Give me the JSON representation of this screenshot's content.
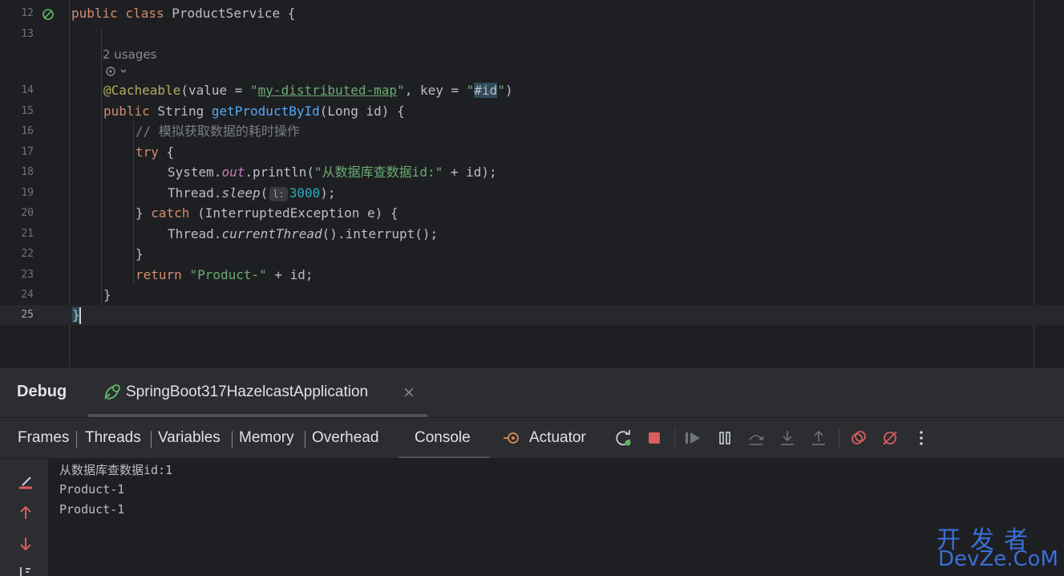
{
  "editor": {
    "line_numbers": [
      "12",
      "13",
      "",
      "",
      "14",
      "15",
      "16",
      "17",
      "18",
      "19",
      "20",
      "21",
      "22",
      "23",
      "24",
      "25"
    ],
    "usages": "2 usages",
    "lines": {
      "l12_public": "public",
      "l12_class": "class",
      "l12_name": "ProductService",
      "l12_brace": "{",
      "l14_ann": "@Cacheable",
      "l14_a": "(value = ",
      "l14_q1": "\"",
      "l14_map": "my-distributed-map",
      "l14_q2": "\"",
      "l14_b": ", key = ",
      "l14_q3": "\"",
      "l14_id": "#id",
      "l14_q4": "\"",
      "l14_c": ")",
      "l15_public": "public",
      "l15_type": "String",
      "l15_fn": "getProductById",
      "l15_params": "(Long id) {",
      "l16_comment": "// 模拟获取数据的耗时操作",
      "l17_try": "try",
      "l17_brace": " {",
      "l18_a": "System.",
      "l18_out": "out",
      "l18_b": ".println(",
      "l18_str": "\"从数据库查数据id:\"",
      "l18_c": " + id);",
      "l19_a": "Thread.",
      "l19_sleep": "sleep",
      "l19_b": "(",
      "l19_hint": "l:",
      "l19_num": "3000",
      "l19_c": ");",
      "l20_a": "} ",
      "l20_catch": "catch",
      "l20_b": " (InterruptedException e) {",
      "l21_a": "Thread.",
      "l21_ct": "currentThread",
      "l21_b": "().interrupt();",
      "l22": "}",
      "l23_return": "return",
      "l23_str": "\"Product-\"",
      "l23_b": " + id;",
      "l24": "}",
      "l25": "}"
    }
  },
  "debug": {
    "title": "Debug",
    "session": "SpringBoot317HazelcastApplication",
    "close": "×",
    "tabs": [
      "Frames",
      "Threads",
      "Variables",
      "Memory",
      "Overhead"
    ],
    "console_tab": "Console",
    "actuator_tab": "Actuator",
    "console_lines": [
      "从数据库查数据id:1",
      "Product-1",
      "Product-1"
    ]
  },
  "watermark": {
    "top": "开发者",
    "bottom": "DevZe.CoM"
  },
  "colors": {
    "accent": "#3574f0",
    "stop": "#db5c5c",
    "run": "#5fb865",
    "keyword": "#cf8e6d",
    "string": "#6aab73",
    "function": "#56a8f5"
  }
}
